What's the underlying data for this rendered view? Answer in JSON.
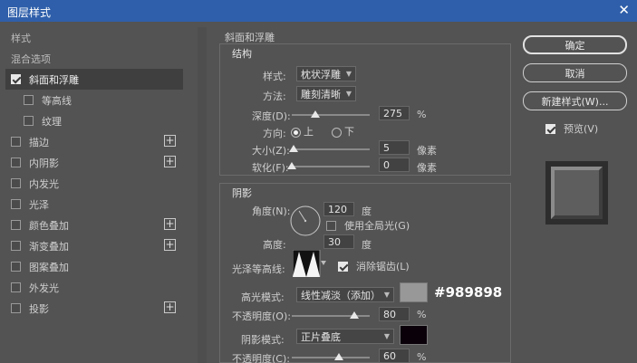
{
  "window": {
    "title": "图层样式",
    "close_glyph": "✕"
  },
  "left_panel": {
    "header_style": "样式",
    "header_blend": "混合选项",
    "items": [
      {
        "label": "斜面和浮雕",
        "checked": true,
        "selected": true,
        "indent": false,
        "plus": false
      },
      {
        "label": "等高线",
        "checked": false,
        "selected": false,
        "indent": true,
        "plus": false
      },
      {
        "label": "纹理",
        "checked": false,
        "selected": false,
        "indent": true,
        "plus": false
      },
      {
        "label": "描边",
        "checked": false,
        "selected": false,
        "indent": false,
        "plus": true
      },
      {
        "label": "内阴影",
        "checked": false,
        "selected": false,
        "indent": false,
        "plus": true
      },
      {
        "label": "内发光",
        "checked": false,
        "selected": false,
        "indent": false,
        "plus": false
      },
      {
        "label": "光泽",
        "checked": false,
        "selected": false,
        "indent": false,
        "plus": false
      },
      {
        "label": "颜色叠加",
        "checked": false,
        "selected": false,
        "indent": false,
        "plus": true
      },
      {
        "label": "渐变叠加",
        "checked": false,
        "selected": false,
        "indent": false,
        "plus": true
      },
      {
        "label": "图案叠加",
        "checked": false,
        "selected": false,
        "indent": false,
        "plus": false
      },
      {
        "label": "外发光",
        "checked": false,
        "selected": false,
        "indent": false,
        "plus": false
      },
      {
        "label": "投影",
        "checked": false,
        "selected": false,
        "indent": false,
        "plus": true
      }
    ]
  },
  "bevel": {
    "section_title": "斜面和浮雕",
    "structure_title": "结构",
    "style_label": "样式:",
    "style_value": "枕状浮雕",
    "technique_label": "方法:",
    "technique_value": "雕刻清晰",
    "depth_label": "深度(D):",
    "depth_value": "275",
    "depth_unit": "%",
    "depth_level": 0.3,
    "direction_label": "方向:",
    "direction_up": "上",
    "direction_down": "下",
    "size_label": "大小(Z):",
    "size_value": "5",
    "size_unit": "像素",
    "size_level": 0.02,
    "soften_label": "软化(F):",
    "soften_value": "0",
    "soften_unit": "像素",
    "soften_level": 0.0
  },
  "shading": {
    "title": "阴影",
    "angle_label": "角度(N):",
    "angle_value": "120",
    "angle_unit": "度",
    "global_light_label": "使用全局光(G)",
    "global_light_checked": false,
    "altitude_label": "高度:",
    "altitude_value": "30",
    "altitude_unit": "度",
    "gloss_label": "光泽等高线:",
    "antialias_label": "消除锯齿(L)",
    "antialias_checked": true,
    "highlight_mode_label": "高光模式:",
    "highlight_mode_value": "线性减淡（添加）",
    "highlight_color": "#989898",
    "highlight_color_annotation": "#989898",
    "highlight_opacity_label": "不透明度(O):",
    "highlight_opacity_value": "80",
    "highlight_opacity_unit": "%",
    "highlight_opacity_level": 0.8,
    "shadow_mode_label": "阴影模式:",
    "shadow_mode_value": "正片叠底",
    "shadow_color": "#0a000a",
    "shadow_opacity_label": "不透明度(C):",
    "shadow_opacity_value": "60",
    "shadow_opacity_unit": "%",
    "shadow_opacity_level": 0.6
  },
  "buttons": {
    "ok": "确定",
    "cancel": "取消",
    "new_style": "新建样式(W)...",
    "preview_label": "预览(V)",
    "preview_checked": true
  },
  "colors": {
    "titlebar": "#2f5faa",
    "dialog_bg": "#535353",
    "accent_text": "#ffffff"
  }
}
